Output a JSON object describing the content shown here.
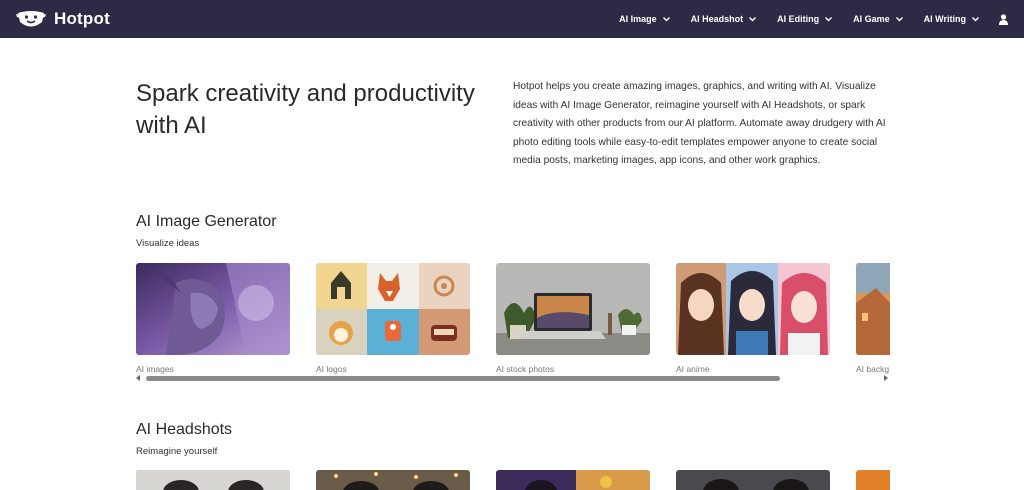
{
  "brand": {
    "name": "Hotpot"
  },
  "nav": {
    "items": [
      {
        "label": "AI Image"
      },
      {
        "label": "AI Headshot"
      },
      {
        "label": "AI Editing"
      },
      {
        "label": "AI Game"
      },
      {
        "label": "AI Writing"
      }
    ]
  },
  "hero": {
    "title": "Spark creativity and productivity with AI",
    "description": "Hotpot helps you create amazing images, graphics, and writing with AI. Visualize ideas with AI Image Generator, reimagine yourself with AI Headshots, or spark creativity with other products from our AI platform. Automate away drudgery with AI photo editing tools while easy-to-edit templates empower anyone to create social media posts, marketing images, app icons, and other work graphics."
  },
  "sections": [
    {
      "title": "AI Image Generator",
      "subtitle": "Visualize ideas",
      "cards": [
        {
          "label": "AI images"
        },
        {
          "label": "AI logos"
        },
        {
          "label": "AI stock photos"
        },
        {
          "label": "AI anime"
        },
        {
          "label": "AI backg"
        }
      ]
    },
    {
      "title": "AI Headshots",
      "subtitle": "Reimagine yourself"
    }
  ],
  "colors": {
    "topbar": "#2d2a45",
    "accent": "#ffffff"
  }
}
